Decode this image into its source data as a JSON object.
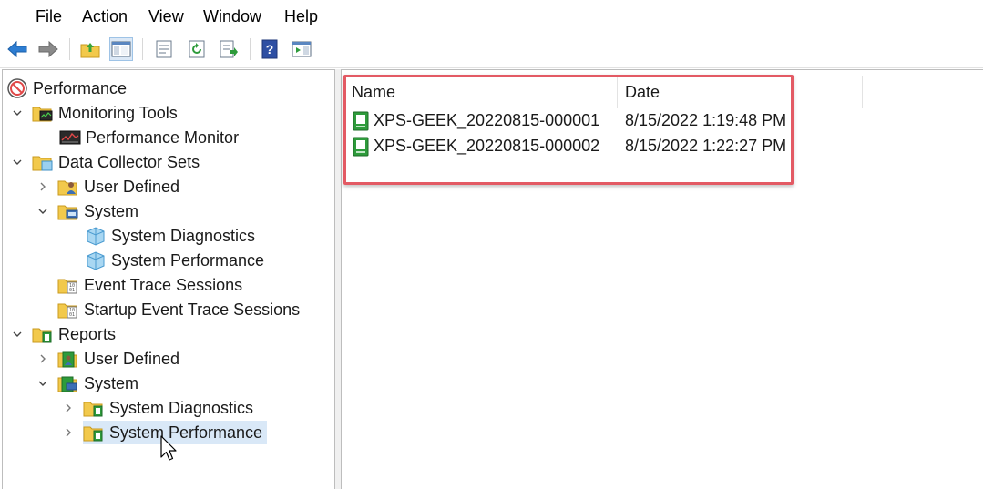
{
  "menu": {
    "items": [
      "File",
      "Action",
      "View",
      "Window",
      "Help"
    ]
  },
  "toolbar": {
    "buttons": [
      {
        "icon": "back-arrow-icon"
      },
      {
        "icon": "forward-arrow-icon"
      },
      {
        "icon": "up-folder-icon"
      },
      {
        "icon": "show-hide-tree-icon"
      },
      {
        "icon": "properties-icon"
      },
      {
        "icon": "refresh-icon"
      },
      {
        "icon": "export-list-icon"
      },
      {
        "icon": "help-icon"
      },
      {
        "icon": "show-action-pane-icon"
      }
    ]
  },
  "tree": {
    "items": [
      {
        "label": "Performance"
      },
      {
        "label": "Monitoring Tools"
      },
      {
        "label": "Performance Monitor"
      },
      {
        "label": "Data Collector Sets"
      },
      {
        "label": "User Defined"
      },
      {
        "label": "System"
      },
      {
        "label": "System Diagnostics"
      },
      {
        "label": "System Performance"
      },
      {
        "label": "Event Trace Sessions"
      },
      {
        "label": "Startup Event Trace Sessions"
      },
      {
        "label": "Reports"
      },
      {
        "label": "User Defined"
      },
      {
        "label": "System"
      },
      {
        "label": "System Diagnostics"
      },
      {
        "label": "System Performance"
      }
    ]
  },
  "list": {
    "columns": [
      "Name",
      "Date"
    ],
    "rows": [
      {
        "name": "XPS-GEEK_20220815-000001",
        "date": "8/15/2022 1:19:48 PM"
      },
      {
        "name": "XPS-GEEK_20220815-000002",
        "date": "8/15/2022 1:22:27 PM"
      }
    ]
  },
  "colors": {
    "highlight": "#e35a64",
    "selection": "#d9e8f7",
    "report_green": "#2e9b3b"
  }
}
